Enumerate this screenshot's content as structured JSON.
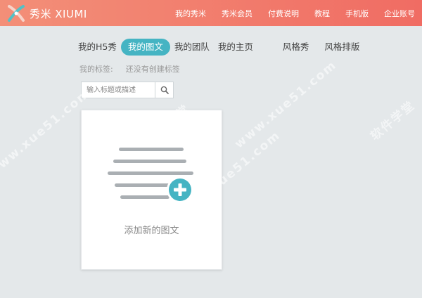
{
  "header": {
    "logo_text": "秀米 XIUMI",
    "nav": [
      "我的秀米",
      "秀米会员",
      "付费说明",
      "教程",
      "手机版",
      "企业账号"
    ]
  },
  "tabs": [
    "我的H5秀",
    "我的图文",
    "我的团队",
    "我的主页",
    "风格秀",
    "风格排版"
  ],
  "tags": {
    "label": "我的标签:",
    "empty_text": "还没有创建标签"
  },
  "search": {
    "placeholder": "输入标题或描述"
  },
  "card": {
    "add_label": "添加新的图文"
  },
  "watermark": {
    "site": "www.xue51.com",
    "name": "软件学堂"
  },
  "colors": {
    "header_start": "#f38f78",
    "header_end": "#f06c63",
    "accent": "#45b4c3"
  }
}
